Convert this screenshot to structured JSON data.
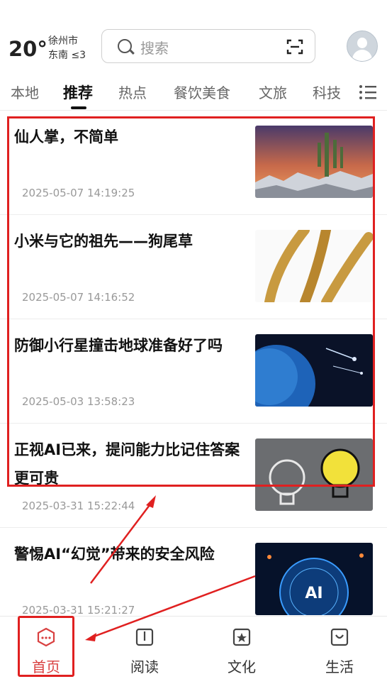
{
  "weather": {
    "temperature": "20°",
    "city": "徐州市",
    "wind": "东南 ≤3"
  },
  "search": {
    "placeholder": "搜索"
  },
  "tabs": [
    "本地",
    "推荐",
    "热点",
    "餐饮美食",
    "文旅",
    "科技"
  ],
  "active_tab": "推荐",
  "articles": [
    {
      "title": "仙人掌，不简单",
      "date": "2025-05-07 14:19:25",
      "thumb": "cactus-image"
    },
    {
      "title": "小米与它的祖先——狗尾草",
      "date": "2025-05-07 14:16:52",
      "thumb": "millet-image"
    },
    {
      "title": "防御小行星撞击地球准备好了吗",
      "date": "2025-05-03 13:58:23",
      "thumb": "planet-image"
    },
    {
      "title": "正视AI已来，提问能力比记住答案更可贵",
      "date": "2025-03-31 15:22:44",
      "thumb": "lightbulb-image"
    },
    {
      "title": "警惕AI“幻觉”带来的安全风险",
      "date": "2025-03-31 15:21:27",
      "thumb": "ai-image"
    }
  ],
  "bottom_nav": [
    {
      "label": "首页",
      "icon": "home-icon",
      "active": true
    },
    {
      "label": "阅读",
      "icon": "book-icon",
      "active": false
    },
    {
      "label": "文化",
      "icon": "star-icon",
      "active": false
    },
    {
      "label": "生活",
      "icon": "bag-icon",
      "active": false
    }
  ],
  "colors": {
    "accent": "#e02020",
    "text": "#111111",
    "muted": "#999999"
  }
}
